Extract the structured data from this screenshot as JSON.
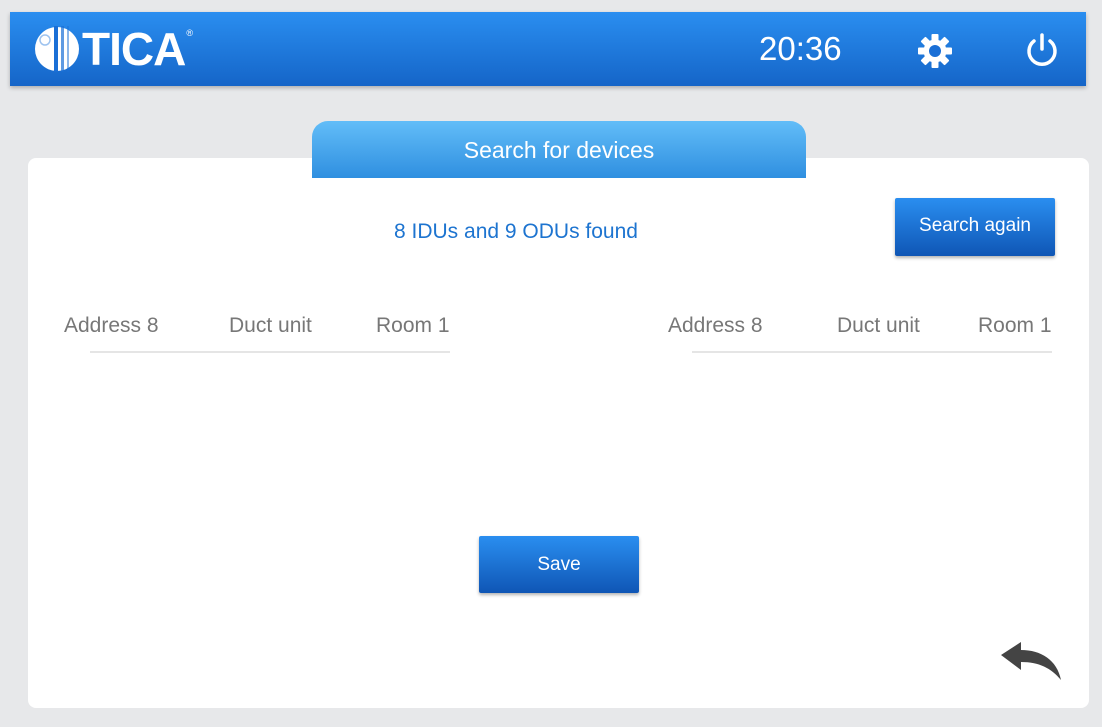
{
  "header": {
    "logo_text": "TICA",
    "logo_reg": "®",
    "time": "20:36",
    "bg_color": "#1a78e0"
  },
  "icons": {
    "settings": "gear-icon",
    "power": "power-icon",
    "back": "back-arrow-icon"
  },
  "tab": {
    "title": "Search for devices"
  },
  "status": {
    "found_text": "8 IDUs and 9 ODUs found",
    "color": "#1d74d0"
  },
  "buttons": {
    "search_again": "Search again",
    "save": "Save"
  },
  "devices": [
    {
      "address": "Address 8",
      "type": "Duct unit",
      "room": "Room 1"
    },
    {
      "address": "Address 8",
      "type": "Duct unit",
      "room": "Room 1"
    }
  ]
}
